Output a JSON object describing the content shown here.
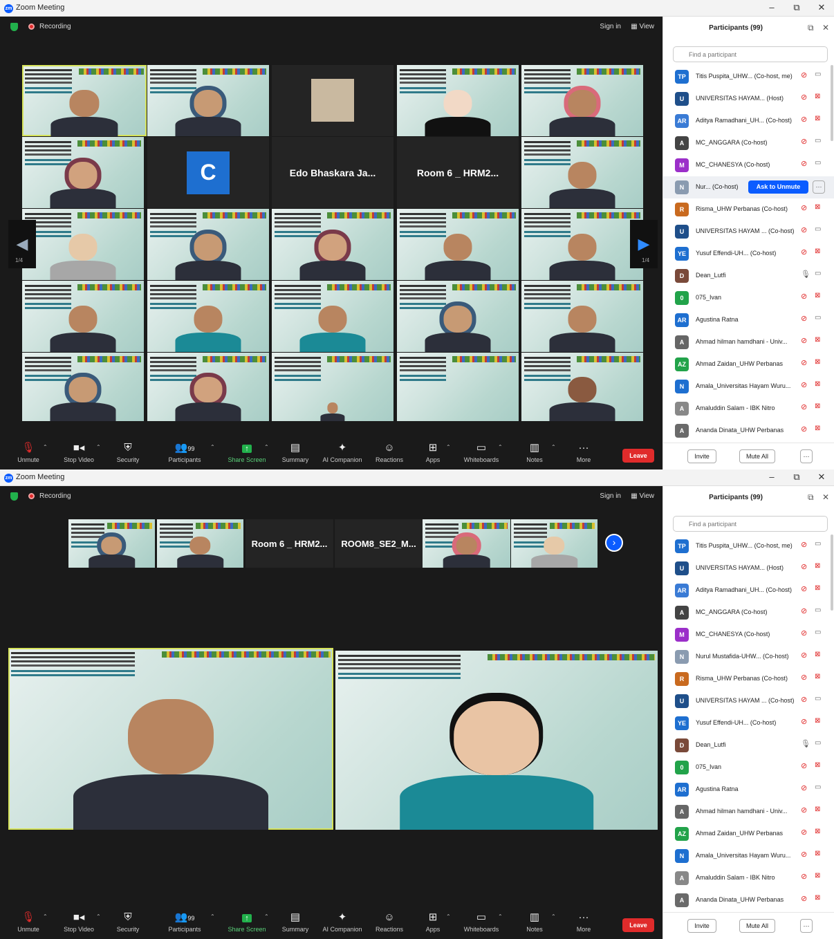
{
  "window": {
    "app_title": "Zoom Meeting",
    "minimize": "–",
    "restore": "⧉",
    "close": "✕"
  },
  "stage": {
    "recording": "Recording",
    "sign_in": "Sign in",
    "view": "View"
  },
  "gallery": {
    "name_tiles": [
      "C",
      "Edo Bhaskara Ja...",
      "Room 6 _ HRM2..."
    ],
    "page_left": "1/4",
    "page_right": "1/4"
  },
  "speaker_strip": {
    "names": [
      "Room 6 _ HRM2...",
      "ROOM8_SE2_M..."
    ]
  },
  "toolbar": {
    "unmute": "Unmute",
    "stop_video": "Stop Video",
    "security": "Security",
    "participants": "Participants",
    "participants_count": "99",
    "share_screen": "Share Screen",
    "summary": "Summary",
    "ai_companion": "AI Companion",
    "reactions": "Reactions",
    "apps": "Apps",
    "whiteboards": "Whiteboards",
    "notes": "Notes",
    "more": "More",
    "leave": "Leave"
  },
  "panel": {
    "title": "Participants (99)",
    "search_placeholder": "Find a participant",
    "invite": "Invite",
    "mute_all": "Mute All",
    "more": "···",
    "ask_to_unmute": "Ask to Unmute",
    "participants_a": [
      {
        "initials": "TP",
        "color": "#1e6fd0",
        "name": "Titis Puspita_UHW...  (Co-host, me)",
        "mic": "muted",
        "cam": "on"
      },
      {
        "initials": "U",
        "color": "#1f4f8a",
        "name": "UNIVERSITAS HAYAM...  (Host)",
        "mic": "muted",
        "cam": "off"
      },
      {
        "initials": "AR",
        "color": "#3a7bd5",
        "name": "Aditya Ramadhani_UH...  (Co-host)",
        "mic": "muted",
        "cam": "off"
      },
      {
        "initials": "A",
        "color": "#444444",
        "name": "MC_ANGGARA  (Co-host)",
        "mic": "muted",
        "cam": "on"
      },
      {
        "initials": "M",
        "color": "#9b2fc9",
        "name": "MC_CHANESYA  (Co-host)",
        "mic": "muted",
        "cam": "on"
      },
      {
        "initials": "N",
        "color": "#8a9bb0",
        "name": "Nur...  (Co-host)",
        "mic": "",
        "cam": ""
      },
      {
        "initials": "R",
        "color": "#c96a1f",
        "name": "Risma_UHW Perbanas  (Co-host)",
        "mic": "muted",
        "cam": "off"
      },
      {
        "initials": "U",
        "color": "#1f4f8a",
        "name": "UNIVERSITAS HAYAM ...  (Co-host)",
        "mic": "muted",
        "cam": "on"
      },
      {
        "initials": "YE",
        "color": "#1e6fd0",
        "name": "Yusuf Effendi-UH...  (Co-host)",
        "mic": "muted",
        "cam": "off"
      },
      {
        "initials": "D",
        "color": "#7a4a3a",
        "name": "Dean_Lutfi",
        "mic": "on",
        "cam": "on"
      },
      {
        "initials": "0",
        "color": "#22a34a",
        "name": "075_Ivan",
        "mic": "muted",
        "cam": "off"
      },
      {
        "initials": "AR",
        "color": "#1e6fd0",
        "name": "Agustina Ratna",
        "mic": "muted",
        "cam": "on"
      },
      {
        "initials": "A",
        "color": "#666666",
        "name": "Ahmad hilman hamdhani - Univ...",
        "mic": "muted",
        "cam": "off"
      },
      {
        "initials": "AZ",
        "color": "#22a34a",
        "name": "Ahmad Zaidan_UHW Perbanas",
        "mic": "muted",
        "cam": "off"
      },
      {
        "initials": "N",
        "color": "#1e6fd0",
        "name": "Amala_Universitas Hayam Wuru...",
        "mic": "muted",
        "cam": "off"
      },
      {
        "initials": "A",
        "color": "#888888",
        "name": "Amaluddin Salam - IBK Nitro",
        "mic": "muted",
        "cam": "off"
      },
      {
        "initials": "A",
        "color": "#6a6a6a",
        "name": "Ananda Dinata_UHW Perbanas",
        "mic": "muted",
        "cam": "off"
      }
    ],
    "participant_b6": "Nurul Mustafida-UHW...  (Co-host)"
  },
  "colors": {
    "accent": "#0b5cff",
    "leave": "#e02b2b",
    "share": "#22b14c",
    "active_speaker": "#d6e35a"
  }
}
